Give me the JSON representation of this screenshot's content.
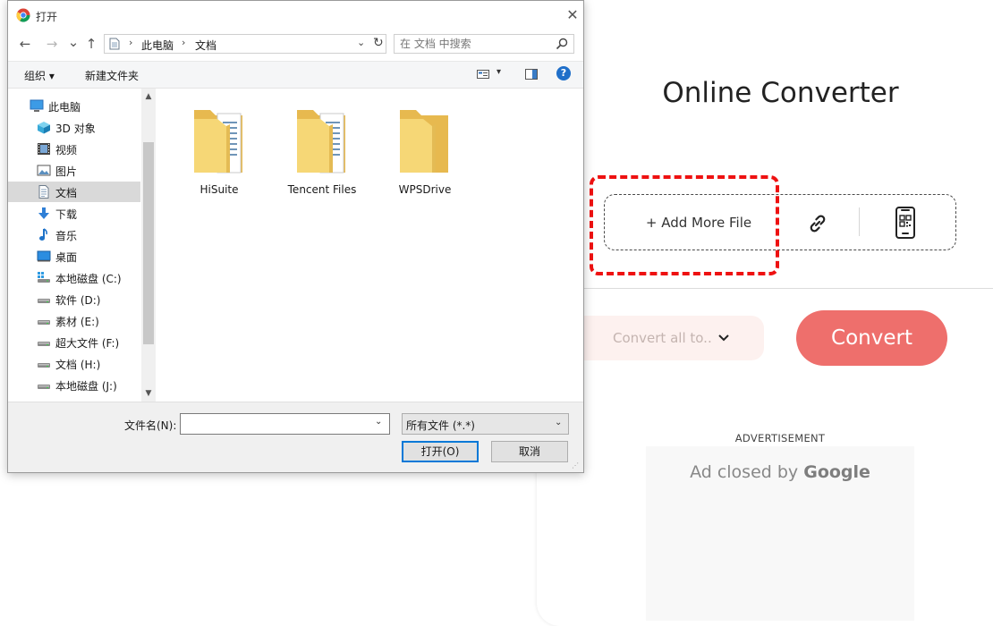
{
  "converter_page": {
    "title": "Online Converter",
    "add_file_label": "+ Add More File",
    "link_icon": "link-icon",
    "qr_icon": "qr-phone-icon",
    "convert_all_label": "Convert all to..",
    "convert_button": "Convert",
    "ad_label": "ADVERTISEMENT",
    "ad_closed_text": "Ad closed by",
    "ad_closed_brand": "Google",
    "accent_color": "#ee6f6c",
    "highlight_color": "#ee1111"
  },
  "dialog": {
    "title": "打开",
    "close_glyph": "✕",
    "nav": {
      "back": "←",
      "forward": "→",
      "recent": "⌄",
      "up": "↑"
    },
    "breadcrumb": [
      "此电脑",
      "文档"
    ],
    "breadcrumb_sep": "›",
    "address_drop": "⌄",
    "refresh": "↻",
    "search_placeholder": "在 文档 中搜索",
    "toolbar": {
      "organize": "组织 ▾",
      "new_folder": "新建文件夹",
      "view_drop": "▾",
      "help": "?"
    },
    "sidebar": [
      {
        "label": "此电脑",
        "icon": "pc-icon",
        "indent": 0
      },
      {
        "label": "3D 对象",
        "icon": "cube-3d-icon",
        "indent": 1
      },
      {
        "label": "视频",
        "icon": "video-icon",
        "indent": 1
      },
      {
        "label": "图片",
        "icon": "picture-icon",
        "indent": 1
      },
      {
        "label": "文档",
        "icon": "document-icon",
        "indent": 1,
        "selected": true
      },
      {
        "label": "下载",
        "icon": "download-icon",
        "indent": 1
      },
      {
        "label": "音乐",
        "icon": "music-icon",
        "indent": 1
      },
      {
        "label": "桌面",
        "icon": "desktop-icon",
        "indent": 1
      },
      {
        "label": "本地磁盘 (C:)",
        "icon": "system-drive-icon",
        "indent": 1
      },
      {
        "label": "软件 (D:)",
        "icon": "drive-icon",
        "indent": 1
      },
      {
        "label": "素材 (E:)",
        "icon": "drive-icon",
        "indent": 1
      },
      {
        "label": "超大文件 (F:)",
        "icon": "drive-icon",
        "indent": 1
      },
      {
        "label": "文档 (H:)",
        "icon": "drive-icon",
        "indent": 1
      },
      {
        "label": "本地磁盘 (J:)",
        "icon": "drive-icon",
        "indent": 1
      }
    ],
    "scroll": {
      "up": "▲",
      "down": "▼"
    },
    "files": [
      {
        "name": "HiSuite",
        "icon": "folder-with-docs-icon"
      },
      {
        "name": "Tencent Files",
        "icon": "folder-with-docs-icon"
      },
      {
        "name": "WPSDrive",
        "icon": "folder-icon"
      }
    ],
    "footer": {
      "filename_label": "文件名(N):",
      "filename_value": "",
      "filename_drop": "⌄",
      "filetype": "所有文件 (*.*)",
      "filetype_drop": "⌄",
      "open_button": "打开(O)",
      "cancel_button": "取消",
      "grip": "⋰"
    }
  }
}
